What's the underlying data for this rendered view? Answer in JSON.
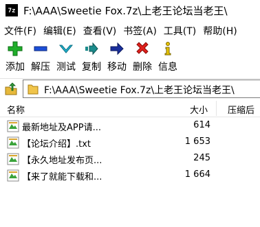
{
  "window": {
    "app_icon_text": "7z",
    "title": "F:\\AAA\\Sweetie Fox.7z\\上老王论坛当老王\\"
  },
  "menu": [
    "文件(F)",
    "编辑(E)",
    "查看(V)",
    "书签(A)",
    "工具(T)",
    "帮助(H)"
  ],
  "toolbar": {
    "add": "添加",
    "extract": "解压",
    "test": "测试",
    "copy": "复制",
    "move": "移动",
    "delete": "删除",
    "info": "信息"
  },
  "address": {
    "path": "F:\\AAA\\Sweetie Fox.7z\\上老王论坛当老王\\"
  },
  "columns": {
    "name": "名称",
    "size": "大小",
    "packed": "压缩后"
  },
  "files": [
    {
      "name": "最新地址及APP请...",
      "size": "614"
    },
    {
      "name": "【论坛介绍】.txt",
      "size": "1 653"
    },
    {
      "name": "【永久地址发布页...",
      "size": "245"
    },
    {
      "name": "【来了就能下载和...",
      "size": "1 664"
    }
  ],
  "colors": {
    "add_green": "#1fae2a",
    "extract_blue": "#1c4fd8",
    "test_cyan": "#21b7d4",
    "copy_teal": "#1b8c8c",
    "move_navy": "#1a2f9c",
    "delete_red": "#e0201c",
    "info_yellow": "#e8c400"
  }
}
